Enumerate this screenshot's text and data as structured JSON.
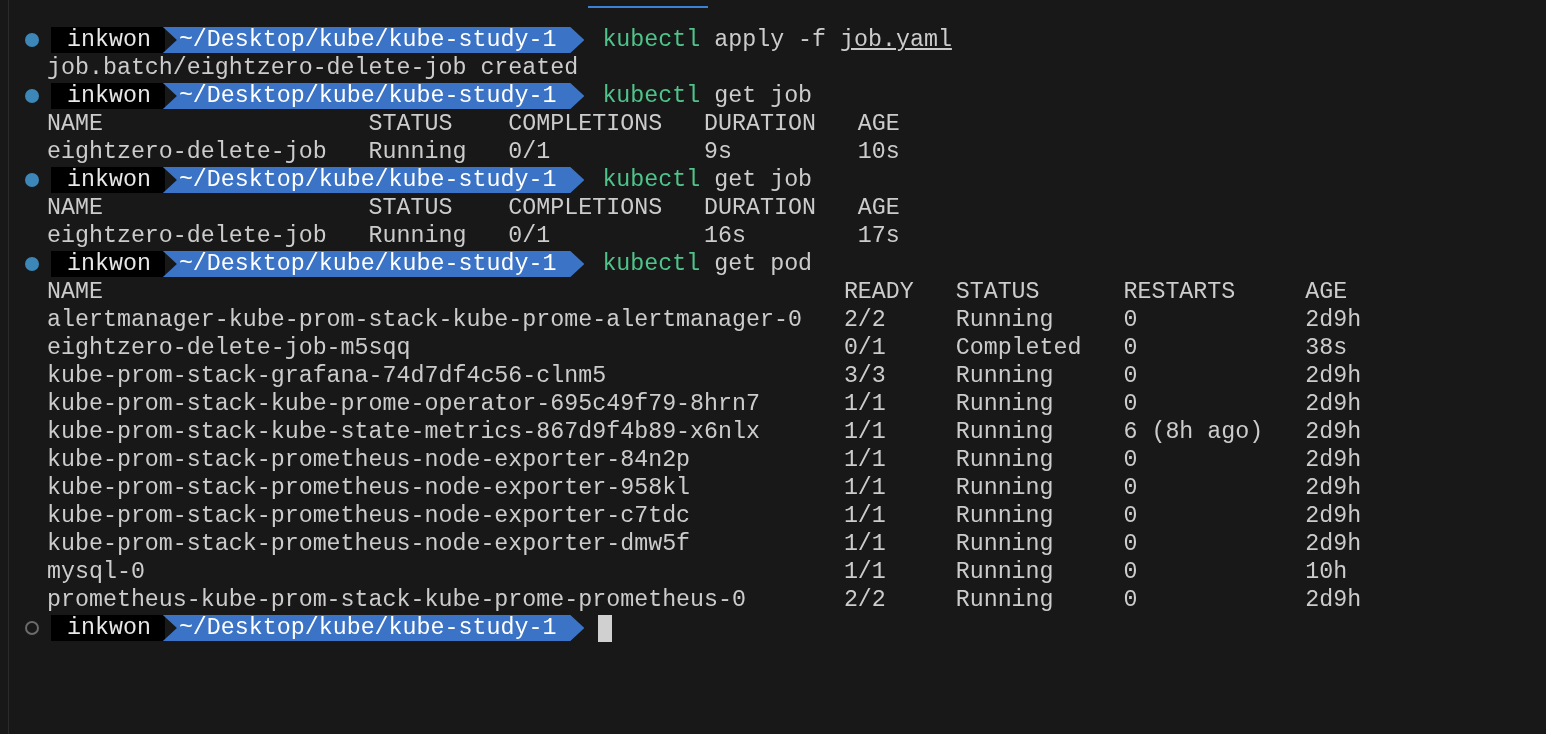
{
  "blocks": [
    {
      "prompt": {
        "completed": true,
        "user": "inkwon",
        "path": "~/Desktop/kube/kube-study-1"
      },
      "command": [
        {
          "kind": "program",
          "text": "kubectl"
        },
        {
          "kind": "arg",
          "text": "apply -f"
        },
        {
          "kind": "file",
          "text": "job.yaml"
        }
      ],
      "output": [
        {
          "kind": "text",
          "text": "job.batch/eightzero-delete-job created"
        }
      ]
    },
    {
      "prompt": {
        "completed": true,
        "user": "inkwon",
        "path": "~/Desktop/kube/kube-study-1"
      },
      "command": [
        {
          "kind": "program",
          "text": "kubectl"
        },
        {
          "kind": "arg",
          "text": "get job"
        }
      ],
      "output": [
        {
          "kind": "table",
          "columns": [
            "NAME",
            "STATUS",
            "COMPLETIONS",
            "DURATION",
            "AGE"
          ],
          "rows": [
            [
              "eightzero-delete-job",
              "Running",
              "0/1",
              "9s",
              "10s"
            ]
          ]
        }
      ]
    },
    {
      "prompt": {
        "completed": true,
        "user": "inkwon",
        "path": "~/Desktop/kube/kube-study-1"
      },
      "command": [
        {
          "kind": "program",
          "text": "kubectl"
        },
        {
          "kind": "arg",
          "text": "get job"
        }
      ],
      "output": [
        {
          "kind": "table",
          "columns": [
            "NAME",
            "STATUS",
            "COMPLETIONS",
            "DURATION",
            "AGE"
          ],
          "rows": [
            [
              "eightzero-delete-job",
              "Running",
              "0/1",
              "16s",
              "17s"
            ]
          ]
        }
      ]
    },
    {
      "prompt": {
        "completed": true,
        "user": "inkwon",
        "path": "~/Desktop/kube/kube-study-1"
      },
      "command": [
        {
          "kind": "program",
          "text": "kubectl"
        },
        {
          "kind": "arg",
          "text": "get pod"
        }
      ],
      "output": [
        {
          "kind": "table",
          "columns": [
            "NAME",
            "READY",
            "STATUS",
            "RESTARTS",
            "AGE"
          ],
          "rows": [
            [
              "alertmanager-kube-prom-stack-kube-prome-alertmanager-0",
              "2/2",
              "Running",
              "0",
              "2d9h"
            ],
            [
              "eightzero-delete-job-m5sqq",
              "0/1",
              "Completed",
              "0",
              "38s"
            ],
            [
              "kube-prom-stack-grafana-74d7df4c56-clnm5",
              "3/3",
              "Running",
              "0",
              "2d9h"
            ],
            [
              "kube-prom-stack-kube-prome-operator-695c49f79-8hrn7",
              "1/1",
              "Running",
              "0",
              "2d9h"
            ],
            [
              "kube-prom-stack-kube-state-metrics-867d9f4b89-x6nlx",
              "1/1",
              "Running",
              "6 (8h ago)",
              "2d9h"
            ],
            [
              "kube-prom-stack-prometheus-node-exporter-84n2p",
              "1/1",
              "Running",
              "0",
              "2d9h"
            ],
            [
              "kube-prom-stack-prometheus-node-exporter-958kl",
              "1/1",
              "Running",
              "0",
              "2d9h"
            ],
            [
              "kube-prom-stack-prometheus-node-exporter-c7tdc",
              "1/1",
              "Running",
              "0",
              "2d9h"
            ],
            [
              "kube-prom-stack-prometheus-node-exporter-dmw5f",
              "1/1",
              "Running",
              "0",
              "2d9h"
            ],
            [
              "mysql-0",
              "1/1",
              "Running",
              "0",
              "10h"
            ],
            [
              "prometheus-kube-prom-stack-kube-prome-prometheus-0",
              "2/2",
              "Running",
              "0",
              "2d9h"
            ]
          ]
        }
      ]
    },
    {
      "prompt": {
        "completed": false,
        "user": "inkwon",
        "path": "~/Desktop/kube/kube-study-1"
      },
      "cursor": true
    }
  ]
}
